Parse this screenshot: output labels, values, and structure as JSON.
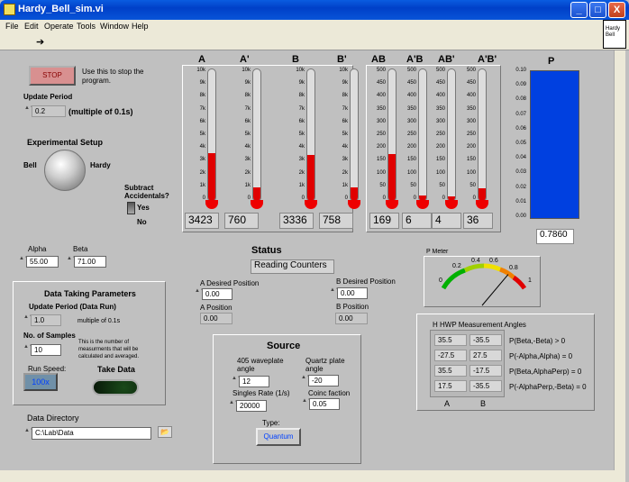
{
  "window": {
    "title": "Hardy_Bell_sim.vi",
    "min": "_",
    "max": "□",
    "close": "X"
  },
  "menu": [
    "File",
    "Edit",
    "Operate",
    "Tools",
    "Window",
    "Help"
  ],
  "vi_icon": "Hardy Bell",
  "stop": {
    "label": "STOP",
    "desc1": "Use this to stop the",
    "desc2": "program."
  },
  "update_period": {
    "label": "Update Period",
    "value": "0.2",
    "unit": "(multiple of 0.1s)"
  },
  "exp_setup": {
    "label": "Experimental Setup",
    "left": "Bell",
    "right": "Hardy"
  },
  "subtract": {
    "label1": "Subtract",
    "label2": "Accidentals?",
    "yes": "Yes",
    "no": "No"
  },
  "alpha": {
    "label": "Alpha",
    "value": "55.00"
  },
  "beta": {
    "label": "Beta",
    "value": "71.00"
  },
  "data_taking": {
    "title": "Data Taking Parameters",
    "period_label": "Update Period (Data Run)",
    "period_value": "1.0",
    "period_unit": "multiple of 0.1s",
    "samples_label": "No. of Samples",
    "samples_value": "10",
    "samples_desc1": "This is the number of",
    "samples_desc2": "measurments that will be",
    "samples_desc3": "calculated and averaged.",
    "speed_label": "Run Speed:",
    "speed_value": "100x",
    "take_label": "Take Data"
  },
  "data_dir": {
    "label": "Data Directory",
    "value": "C:\\Lab\\Data"
  },
  "status": {
    "label": "Status",
    "value": "Reading Counters"
  },
  "a_desired": {
    "label": "A Desired Position",
    "value": "0.00"
  },
  "a_pos": {
    "label": "A Position",
    "value": "0.00"
  },
  "b_desired": {
    "label": "B Desired Position",
    "value": "0.00"
  },
  "b_pos": {
    "label": "B Position",
    "value": "0.00"
  },
  "source": {
    "title": "Source",
    "wp_label1": "405 waveplate",
    "wp_label2": "angle",
    "wp_value": "12",
    "qp_label1": "Quartz plate",
    "qp_label2": "angle",
    "qp_value": "-20",
    "singles_label": "Singles Rate (1/s)",
    "singles_value": "20000",
    "coinc_label": "Coinc faction",
    "coinc_value": "0.05",
    "type_label": "Type:",
    "type_value": "Quantum"
  },
  "thermo_group1": {
    "ticks": [
      "10k",
      "9k",
      "8k",
      "7k",
      "6k",
      "5k",
      "4k",
      "3k",
      "2k",
      "1k",
      "0"
    ],
    "max": 10000,
    "meters": [
      {
        "name": "A",
        "value": 3423,
        "display": "3423"
      },
      {
        "name": "A'",
        "value": 760,
        "display": "760"
      },
      {
        "name": "B",
        "value": 3336,
        "display": "3336"
      },
      {
        "name": "B'",
        "value": 758,
        "display": "758"
      }
    ]
  },
  "thermo_group2": {
    "ticks": [
      "500",
      "450",
      "400",
      "350",
      "300",
      "250",
      "200",
      "150",
      "100",
      "50",
      "0"
    ],
    "max": 500,
    "meters": [
      {
        "name": "AB",
        "value": 169,
        "display": "169"
      },
      {
        "name": "A'B",
        "value": 6,
        "display": "6"
      },
      {
        "name": "AB'",
        "value": 4,
        "display": "4"
      },
      {
        "name": "A'B'",
        "value": 36,
        "display": "36"
      }
    ]
  },
  "p_bar": {
    "label": "P",
    "value": 0.786,
    "display": "0.7860",
    "max": 0.1,
    "ticks": [
      "0.10",
      "0.09",
      "0.08",
      "0.07",
      "0.06",
      "0.05",
      "0.04",
      "0.03",
      "0.02",
      "0.01",
      "0.00"
    ]
  },
  "p_meter": {
    "label": "P Meter",
    "ticks": [
      "0",
      "0.2",
      "0.4",
      "0.6",
      "0.8",
      "1"
    ],
    "value": 0.786
  },
  "hwp": {
    "title": "H HWP Measurement Angles",
    "rows": [
      {
        "a": "35.5",
        "b": "-35.5",
        "eq": "P(Beta,-Beta) > 0"
      },
      {
        "a": "-27.5",
        "b": "27.5",
        "eq": "P(-Alpha,Alpha) = 0"
      },
      {
        "a": "35.5",
        "b": "-17.5",
        "eq": "P(Beta,AlphaPerp) = 0"
      },
      {
        "a": "17.5",
        "b": "-35.5",
        "eq": "P(-AlphaPerp,-Beta) = 0"
      }
    ],
    "col_a": "A",
    "col_b": "B"
  }
}
